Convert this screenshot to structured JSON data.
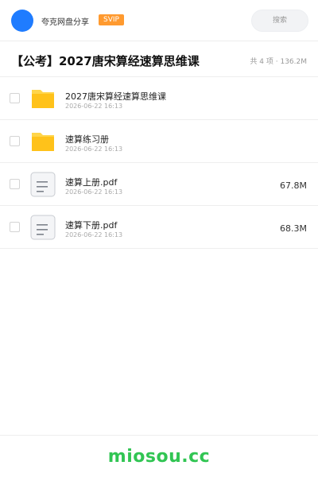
{
  "header": {
    "app_name": "夸克网盘分享",
    "badge": "SVIP",
    "search_placeholder": "搜索",
    "avatar_color": "#1f7cff"
  },
  "share": {
    "title": "【公考】2027唐宋算经速算思维课",
    "meta": "共 4 项 · 136.2M"
  },
  "files": [
    {
      "name": "2027唐宋算经速算思维课",
      "date": "2026-06-22 16:13",
      "size": "",
      "type": "folder",
      "icon": "folder-icon"
    },
    {
      "name": "速算练习册",
      "date": "2026-06-22 16:13",
      "size": "",
      "type": "folder",
      "icon": "folder-icon"
    },
    {
      "name": "速算上册.pdf",
      "date": "2026-06-22 16:13",
      "size": "67.8M",
      "type": "file",
      "icon": "document-icon"
    },
    {
      "name": "速算下册.pdf",
      "date": "2026-06-22 16:13",
      "size": "68.3M",
      "type": "file",
      "icon": "document-icon"
    }
  ],
  "footer": {
    "watermark": "miosou.cc",
    "watermark_color": "#31c553"
  },
  "colors": {
    "folder": "#ffc21a",
    "badge": "#ff9a2f"
  }
}
